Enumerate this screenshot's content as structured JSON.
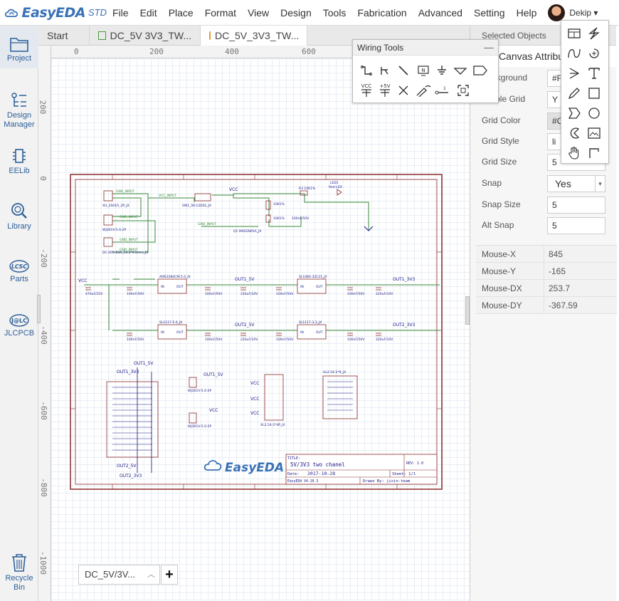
{
  "app": {
    "brand": "EasyEDA",
    "edition": "STD"
  },
  "menu": [
    "File",
    "Edit",
    "Place",
    "Format",
    "View",
    "Design",
    "Tools",
    "Fabrication",
    "Advanced",
    "Setting",
    "Help"
  ],
  "user": {
    "name": "Dekip"
  },
  "sidebar": {
    "items": [
      {
        "label": "Project",
        "icon": "folder-icon"
      },
      {
        "label": "Design Manager",
        "icon": "list-icon"
      },
      {
        "label": "EELib",
        "icon": "chip-icon"
      },
      {
        "label": "Library",
        "icon": "search-library-icon"
      },
      {
        "label": "Parts",
        "icon": "lcsc-icon"
      },
      {
        "label": "JLCPCB",
        "icon": "jlc-icon"
      },
      {
        "label": "Recycle Bin",
        "icon": "trash-icon"
      }
    ]
  },
  "tabs": [
    {
      "label": "Start"
    },
    {
      "label": "DC_5V 3V3_TW..."
    },
    {
      "label": "DC_5V_3V3_TW..."
    }
  ],
  "rulers": {
    "top": [
      "0",
      "200",
      "400",
      "600"
    ],
    "left": [
      "200",
      "0",
      "-200",
      "-400",
      "-600",
      "-800",
      "-1000"
    ]
  },
  "wiring_tools": {
    "title": "Wiring Tools",
    "minimize": "—",
    "texts": [
      "VCC",
      "+5V",
      "N"
    ]
  },
  "schematic": {
    "nets": [
      "GND_INPUT",
      "VCC_INPUT",
      "VCC",
      "OUT1_5V",
      "OUT1_3V3",
      "OUT2_5V",
      "OUT2_3V3"
    ],
    "title_block": {
      "title_label": "TITLE:",
      "title": "5V/3V3 two chanel",
      "rev": "REV: 1.0",
      "date_label": "Date:",
      "date": "2017-10-28",
      "sheet": "Sheet: 1/1",
      "version": "EasyEDA V4.10.3",
      "drawn_by": "Drawn By: jixin-team"
    },
    "brand": "EasyEDA"
  },
  "right_panel": {
    "header": "Selected Objects",
    "section_title": "Canvas Attributes",
    "props": [
      {
        "label": "Background",
        "value": "#F"
      },
      {
        "label": "Visible Grid",
        "value": "Y"
      },
      {
        "label": "Grid Color",
        "value": "#C"
      },
      {
        "label": "Grid Style",
        "value": "li"
      },
      {
        "label": "Grid Size",
        "value": "5"
      },
      {
        "label": "Snap",
        "value": "Yes"
      },
      {
        "label": "Snap Size",
        "value": "5"
      },
      {
        "label": "Alt Snap",
        "value": "5"
      }
    ],
    "mouse": [
      {
        "label": "Mouse-X",
        "value": "845"
      },
      {
        "label": "Mouse-Y",
        "value": "-165"
      },
      {
        "label": "Mouse-DX",
        "value": "253.7"
      },
      {
        "label": "Mouse-DY",
        "value": "-367.59"
      }
    ]
  },
  "doc_tab": {
    "label": "DC_5V/3V...",
    "add": "+"
  }
}
